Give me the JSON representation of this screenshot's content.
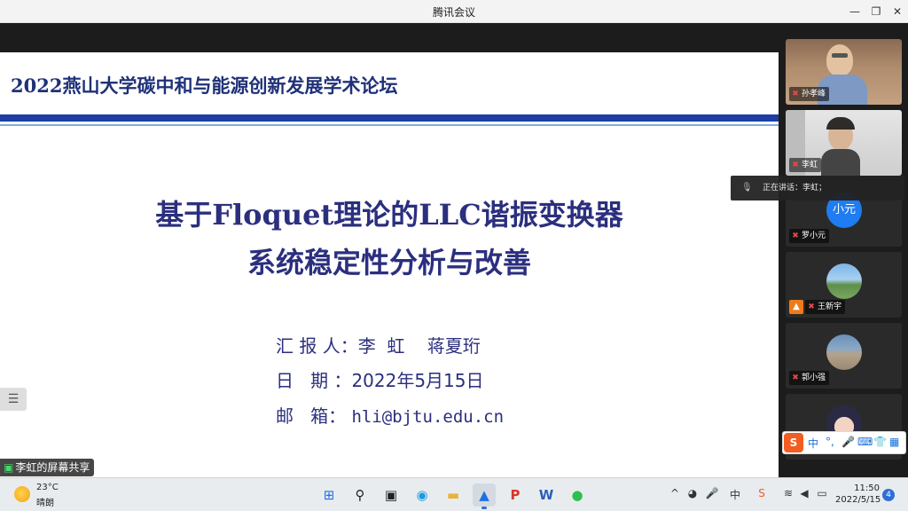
{
  "window": {
    "title": "腾讯会议",
    "minimize_glyph": "—",
    "restore_glyph": "❐",
    "close_glyph": "✕"
  },
  "slide": {
    "header": "2022燕山大学碳中和与能源创新发展学术论坛",
    "title_line1": "基于Floquet理论的LLC谐振变换器",
    "title_line2": "系统稳定性分析与改善",
    "presenter_label": "汇 报 人：",
    "presenter_names": "李  虹    蒋夏珩",
    "date_label": "日   期 ：",
    "date_value": "2022年5月15日",
    "email_label": "邮   箱： ",
    "email_value": "hli@bjtu.edu.cn",
    "list_icon": "☰"
  },
  "participants": [
    {
      "name": "孙孝峰"
    },
    {
      "name": "李虹"
    },
    {
      "name": "罗小元",
      "avatar_text": "小元",
      "avatar_color": "#1f7cf2"
    },
    {
      "name": "王新宇",
      "role_icon": "👤"
    },
    {
      "name": "郭小强"
    },
    {
      "name": ""
    }
  ],
  "speaking": {
    "text": "正在讲话：李虹；"
  },
  "share": {
    "label": "李虹的屏幕共享"
  },
  "ime": {
    "logo": "S",
    "mode": "中",
    "punct": "°,",
    "mic": "🎤",
    "keyboard": "⌨",
    "skin": "👕",
    "grid": "▦"
  },
  "taskbar": {
    "weather_temp": "23°C",
    "weather_desc": "晴朗",
    "clock_time": "11:50",
    "clock_date": "2022/5/15",
    "notification_count": "4",
    "tray_chevron": "^",
    "tray_ime": "中",
    "apps": [
      "⊞",
      "⚲",
      "▣",
      "◉",
      "▬",
      "▲",
      "P",
      "W",
      "●"
    ]
  }
}
